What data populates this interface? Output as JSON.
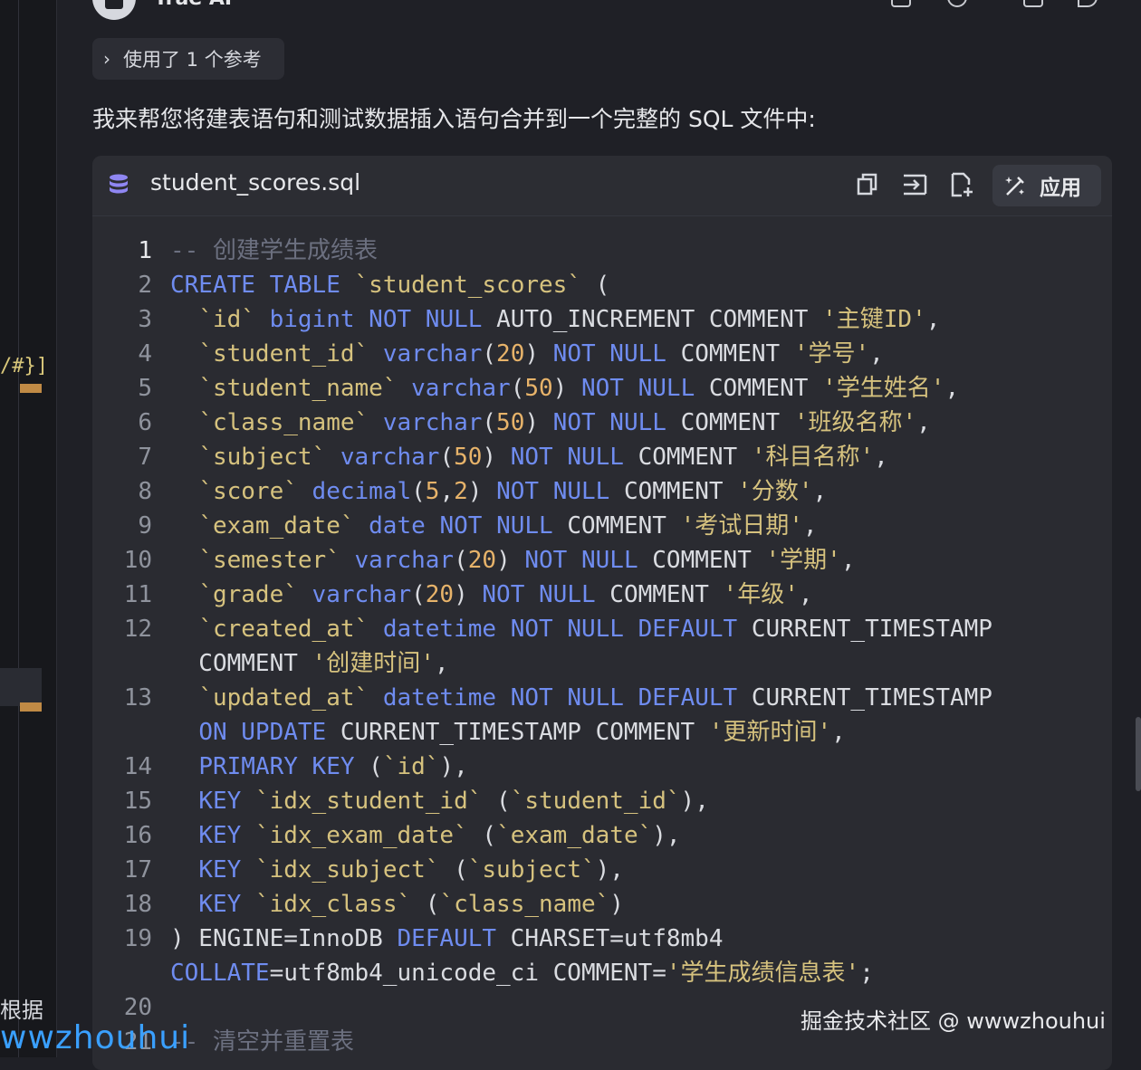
{
  "header": {
    "app_name": "Trae AI"
  },
  "reference_pill": {
    "label": "使用了 1 个参考"
  },
  "intro_text": "我来帮您将建表语句和测试数据插入语句合并到一个完整的 SQL 文件中:",
  "code_card": {
    "filename": "student_scores.sql",
    "apply_label": "应用",
    "lines": [
      {
        "num": "1",
        "text": "-- 创建学生成绩表"
      },
      {
        "num": "2",
        "text": "CREATE TABLE `student_scores` ("
      },
      {
        "num": "3",
        "text": "  `id` bigint NOT NULL AUTO_INCREMENT COMMENT '主键ID',"
      },
      {
        "num": "4",
        "text": "  `student_id` varchar(20) NOT NULL COMMENT '学号',"
      },
      {
        "num": "5",
        "text": "  `student_name` varchar(50) NOT NULL COMMENT '学生姓名',"
      },
      {
        "num": "6",
        "text": "  `class_name` varchar(50) NOT NULL COMMENT '班级名称',"
      },
      {
        "num": "7",
        "text": "  `subject` varchar(50) NOT NULL COMMENT '科目名称',"
      },
      {
        "num": "8",
        "text": "  `score` decimal(5,2) NOT NULL COMMENT '分数',"
      },
      {
        "num": "9",
        "text": "  `exam_date` date NOT NULL COMMENT '考试日期',"
      },
      {
        "num": "10",
        "text": "  `semester` varchar(20) NOT NULL COMMENT '学期',"
      },
      {
        "num": "11",
        "text": "  `grade` varchar(20) NOT NULL COMMENT '年级',"
      },
      {
        "num": "12",
        "text": "  `created_at` datetime NOT NULL DEFAULT CURRENT_TIMESTAMP"
      },
      {
        "num": "",
        "text": "  COMMENT '创建时间',"
      },
      {
        "num": "13",
        "text": "  `updated_at` datetime NOT NULL DEFAULT CURRENT_TIMESTAMP"
      },
      {
        "num": "",
        "text": "  ON UPDATE CURRENT_TIMESTAMP COMMENT '更新时间',"
      },
      {
        "num": "14",
        "text": "  PRIMARY KEY (`id`),"
      },
      {
        "num": "15",
        "text": "  KEY `idx_student_id` (`student_id`),"
      },
      {
        "num": "16",
        "text": "  KEY `idx_exam_date` (`exam_date`),"
      },
      {
        "num": "17",
        "text": "  KEY `idx_subject` (`subject`),"
      },
      {
        "num": "18",
        "text": "  KEY `idx_class` (`class_name`)"
      },
      {
        "num": "19",
        "text": ") ENGINE=InnoDB DEFAULT CHARSET=utf8mb4"
      },
      {
        "num": "",
        "text": "COLLATE=utf8mb4_unicode_ci COMMENT='学生成绩信息表';"
      },
      {
        "num": "20",
        "text": ""
      },
      {
        "num": "21",
        "text": "-- 清空并重置表"
      }
    ]
  },
  "left_fragments": {
    "code_fragment": "/#}]",
    "text_fragment": "根据"
  },
  "watermark": {
    "text": "掘金技术社区 @ wwwzhouhui",
    "overlay": "wwzhouhui"
  },
  "colors": {
    "keyword": "#6f8cf0",
    "identifier": "#d6c27e",
    "number": "#e7b36a",
    "comment": "#6c7080",
    "background": "#1f2026",
    "card": "#2a2b31"
  },
  "icons": [
    "copy-icon",
    "insert-icon",
    "new-file-icon",
    "apply-wand-icon",
    "database-icon",
    "chevron-right-icon"
  ]
}
